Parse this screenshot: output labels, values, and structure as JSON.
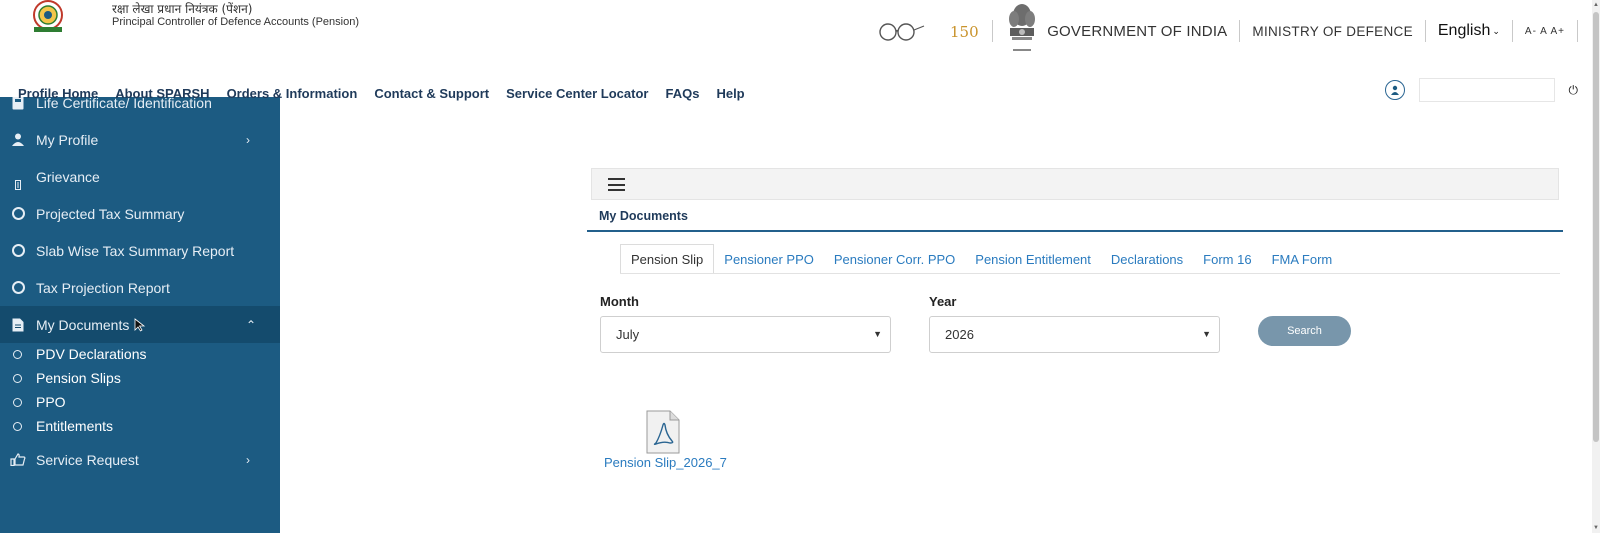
{
  "header": {
    "org_hindi": "रक्षा लेखा प्रधान नियंत्रक (पेंशन)",
    "org_english": "Principal Controller of Defence Accounts (Pension)",
    "government": "GOVERNMENT OF INDIA",
    "ministry": "MINISTRY OF DEFENCE",
    "language": "English",
    "font_sizes": "A- A A+"
  },
  "nav": {
    "items": [
      "Profile Home",
      "About SPARSH",
      "Orders & Information",
      "Contact & Support",
      "Service Center Locator",
      "FAQs",
      "Help"
    ]
  },
  "sidebar": {
    "items": [
      {
        "label": "Life Certificate/ Identification",
        "icon": "id-card-icon"
      },
      {
        "label": "My Profile",
        "icon": "user-icon"
      },
      {
        "label": "Grievance",
        "icon": "grievance-icon"
      },
      {
        "label": "Projected Tax Summary",
        "icon": "circle-icon"
      },
      {
        "label": "Slab Wise Tax Summary Report",
        "icon": "circle-icon"
      },
      {
        "label": "Tax Projection Report",
        "icon": "circle-icon"
      },
      {
        "label": "My Documents",
        "icon": "document-icon"
      },
      {
        "label": "Service Request",
        "icon": "thumbs-up-icon"
      }
    ],
    "sub_items": [
      "PDV Declarations",
      "Pension Slips",
      "PPO",
      "Entitlements"
    ]
  },
  "main": {
    "section_title": "My Documents",
    "tabs": [
      "Pension Slip",
      "Pensioner PPO",
      "Pensioner Corr. PPO",
      "Pension Entitlement",
      "Declarations",
      "Form 16",
      "FMA Form"
    ],
    "month_label": "Month",
    "month_value": "July",
    "year_label": "Year",
    "year_value": "2026",
    "search_label": "Search",
    "document": {
      "name": "Pension Slip_2026_7",
      "icon": "pdf-file-icon"
    }
  },
  "colors": {
    "sidebar_bg": "#1c5b82",
    "sidebar_active": "#144b6d",
    "nav_text": "#1f3a5a",
    "link": "#2a7bbf",
    "search_button": "#7896ab"
  }
}
